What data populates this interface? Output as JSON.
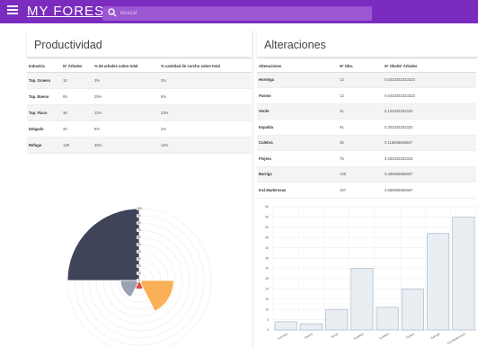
{
  "header": {
    "logo": "MY FOREST",
    "search_placeholder": "Buscar"
  },
  "productividad": {
    "title": "Productividad",
    "columns": [
      "Industria",
      "Nº Árboles",
      "% de arboles sobre total",
      "% cantidad de corcho sobre total"
    ],
    "rows": [
      [
        "Tap. Grueso",
        "10",
        "3%",
        "3%"
      ],
      [
        "Tap. Bueno",
        "89",
        "29%",
        "6%"
      ],
      [
        "Tap. Flaco",
        "36",
        "12%",
        "23%"
      ],
      [
        "Delgado",
        "26",
        "8%",
        "3%"
      ],
      [
        "Refugo",
        "139",
        "46%",
        "12%"
      ]
    ]
  },
  "alteraciones": {
    "title": "Alteraciones",
    "columns": [
      "Alteraciones",
      "Nº Obs.",
      "Nº Obs/Nº Árboles"
    ],
    "rows": [
      [
        "Hormiga",
        "13",
        "0,0433333333333"
      ],
      [
        "Pasmo",
        "13",
        "0,0433333333333"
      ],
      [
        "Verde",
        "31",
        "0,103333333333"
      ],
      [
        "Espalda",
        "91",
        "0,303333333333"
      ],
      [
        "Culebra",
        "35",
        "0,116666666667"
      ],
      [
        "Flojera",
        "76",
        "0,253333333333"
      ],
      [
        "Barriga",
        "149",
        "0,496666666667"
      ],
      [
        "Incl.Maderosas",
        "167",
        "0,556666666667"
      ]
    ]
  },
  "chart_data": [
    {
      "type": "pie",
      "variant": "polar-area",
      "categories": [
        "",
        "",
        "",
        ""
      ],
      "values": [
        100,
        12,
        48,
        26
      ],
      "colors": [
        "#3f4458",
        "#e84545",
        "#f9b057",
        "#9aa2b1"
      ],
      "r_ticks": [
        "0",
        "10",
        "20",
        "30",
        "40",
        "50",
        "60",
        "70",
        "80",
        "90",
        "100"
      ],
      "rlim": [
        0,
        100
      ]
    },
    {
      "type": "bar",
      "categories": [
        "Hormiga",
        "Pasmo",
        "Verde",
        "Espalda",
        "Culebra",
        "Flojera",
        "Barriga",
        "Incl.Maderosas"
      ],
      "values": [
        4,
        3,
        10,
        30,
        11,
        20,
        47,
        55
      ],
      "ylim": [
        0,
        60
      ],
      "y_ticks": [
        "0",
        "5",
        "10",
        "15",
        "20",
        "25",
        "30",
        "35",
        "40",
        "45",
        "50",
        "55",
        "60"
      ],
      "bar_fill": "#e9eef3",
      "bar_stroke": "#a9b8c8",
      "grid": true
    }
  ]
}
